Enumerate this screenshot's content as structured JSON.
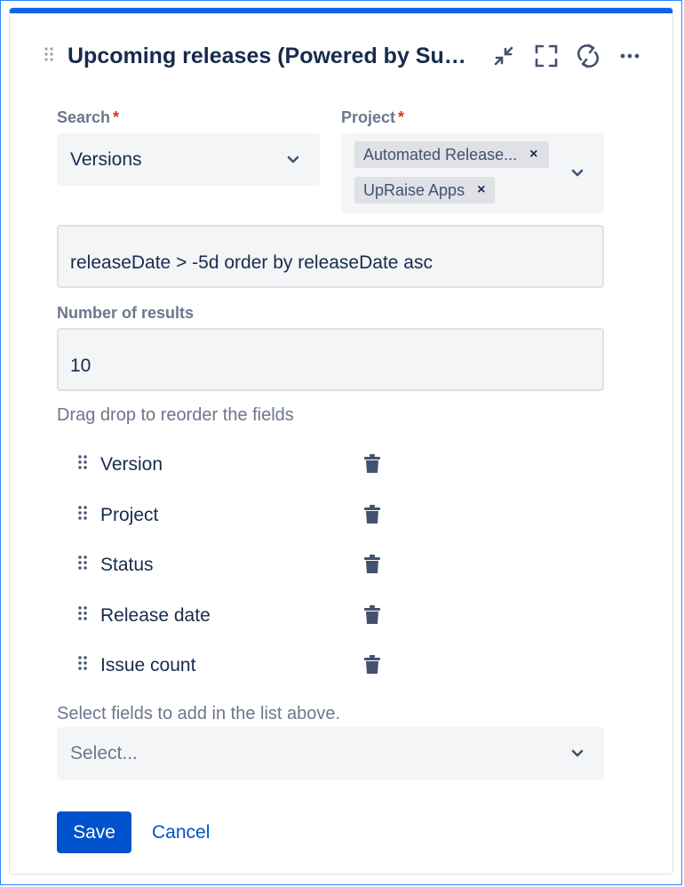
{
  "header": {
    "title": "Upcoming releases (Powered by Super..."
  },
  "search": {
    "label": "Search",
    "required_mark": "*",
    "value": "Versions"
  },
  "project": {
    "label": "Project",
    "required_mark": "*",
    "tags": [
      {
        "label": "Automated Release..."
      },
      {
        "label": "UpRaise Apps"
      }
    ],
    "remove_glyph": "×"
  },
  "query": {
    "value": "releaseDate > -5d order by releaseDate asc"
  },
  "results": {
    "label": "Number of results",
    "value": "10"
  },
  "fields": {
    "hint": "Drag drop to reorder the fields",
    "items": [
      {
        "label": "Version"
      },
      {
        "label": "Project"
      },
      {
        "label": "Status"
      },
      {
        "label": "Release date"
      },
      {
        "label": "Issue count"
      }
    ]
  },
  "add_fields": {
    "label": "Select fields to add in the list above.",
    "placeholder": "Select..."
  },
  "actions": {
    "save_label": "Save",
    "cancel_label": "Cancel"
  },
  "icons": {
    "header": [
      "minimize-icon",
      "fullscreen-icon",
      "refresh-icon",
      "more-icon"
    ],
    "field_row": [
      "drag-handle-icon",
      "trash-icon"
    ],
    "select": "chevron-down-icon"
  },
  "colors": {
    "accent": "#0c66e4",
    "primary_button": "#0052cc",
    "required": "#de350b",
    "field_bg": "#f4f5f7"
  }
}
